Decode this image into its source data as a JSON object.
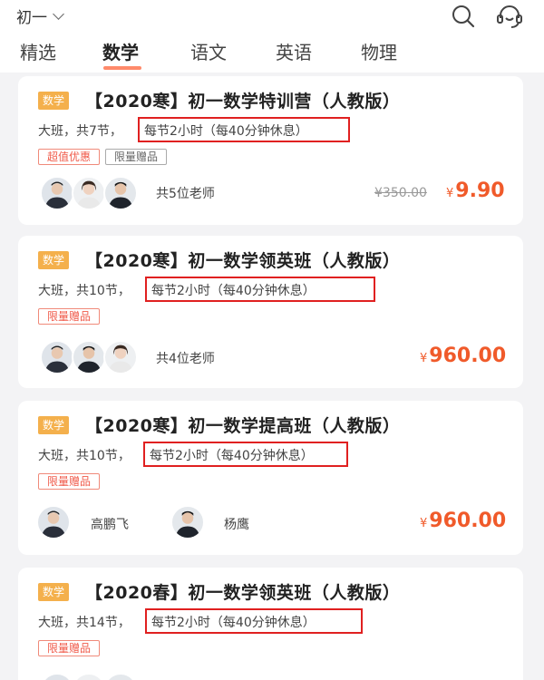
{
  "header": {
    "grade_label": "初一",
    "icons": [
      "search-icon",
      "customer-service-icon"
    ]
  },
  "tabs": [
    {
      "label": "精选",
      "active": false
    },
    {
      "label": "数学",
      "active": true
    },
    {
      "label": "语文",
      "active": false
    },
    {
      "label": "英语",
      "active": false
    },
    {
      "label": "物理",
      "active": false
    }
  ],
  "colors": {
    "accent": "#ff8a6b",
    "price": "#f05a2a",
    "subject_tag": "#f4b04c",
    "highlight_box": "#e02020"
  },
  "courses": [
    {
      "subject": "数学",
      "title": "【2020寒】初一数学特训营（人教版）",
      "class_info": "大班，共7节，",
      "schedule": "每节2小时（每40分钟休息）",
      "badges": [
        "超值优惠",
        "限量赠品"
      ],
      "teacher_count": "共5位老师",
      "original_price": "¥350.00",
      "currency": "¥",
      "price": "9.90"
    },
    {
      "subject": "数学",
      "title": "【2020寒】初一数学领英班（人教版）",
      "class_info": "大班，共10节，",
      "schedule": "每节2小时（每40分钟休息）",
      "badges": [
        "限量赠品"
      ],
      "teacher_count": "共4位老师",
      "currency": "¥",
      "price": "960.00"
    },
    {
      "subject": "数学",
      "title": "【2020寒】初一数学提高班（人教版）",
      "class_info": "大班，共10节，",
      "schedule": "每节2小时（每40分钟休息）",
      "badges": [
        "限量赠品"
      ],
      "teachers": [
        "高鹏飞",
        "杨鹰"
      ],
      "currency": "¥",
      "price": "960.00"
    },
    {
      "subject": "数学",
      "title": "【2020春】初一数学领英班（人教版）",
      "class_info": "大班，共14节，",
      "schedule": "每节2小时（每40分钟休息）",
      "badges": [
        "限量赠品"
      ]
    }
  ]
}
